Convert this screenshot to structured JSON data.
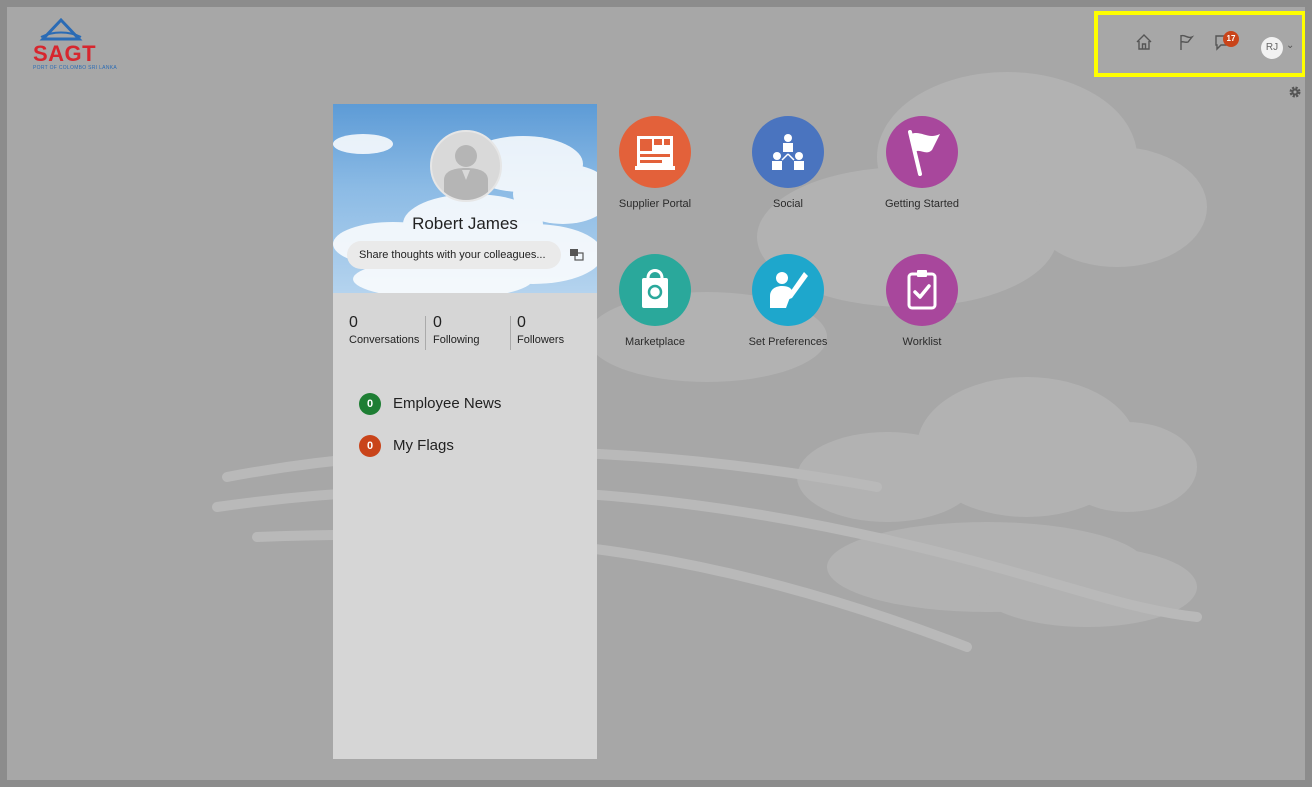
{
  "brand": {
    "name": "SAGT",
    "tagline": "PORT OF COLOMBO SRI LANKA"
  },
  "header": {
    "icons": [
      "home-icon",
      "flag-icon",
      "notifications-icon",
      "user-menu"
    ],
    "notifications_count": "17",
    "user_initials": "RJ",
    "highlight_color": "#ffff00"
  },
  "profile": {
    "name": "Robert James",
    "share_placeholder": "Share thoughts with your colleagues...",
    "stats": [
      {
        "value": "0",
        "label": "Conversations"
      },
      {
        "value": "0",
        "label": "Following"
      },
      {
        "value": "0",
        "label": "Followers"
      }
    ],
    "feeds": [
      {
        "count": "0",
        "label": "Employee News",
        "color": "#1e7e34"
      },
      {
        "count": "0",
        "label": "My Flags",
        "color": "#c9441a"
      }
    ]
  },
  "apps": [
    {
      "label": "Supplier Portal",
      "color": "#e3613a",
      "icon": "supplier-portal-icon"
    },
    {
      "label": "Social",
      "color": "#4a74bf",
      "icon": "social-icon"
    },
    {
      "label": "Getting Started",
      "color": "#a8479c",
      "icon": "getting-started-flag-icon"
    },
    {
      "label": "Marketplace",
      "color": "#2aa89b",
      "icon": "marketplace-bag-icon"
    },
    {
      "label": "Set Preferences",
      "color": "#1ea7cc",
      "icon": "set-preferences-icon"
    },
    {
      "label": "Worklist",
      "color": "#a8479c",
      "icon": "worklist-clipboard-icon"
    }
  ]
}
